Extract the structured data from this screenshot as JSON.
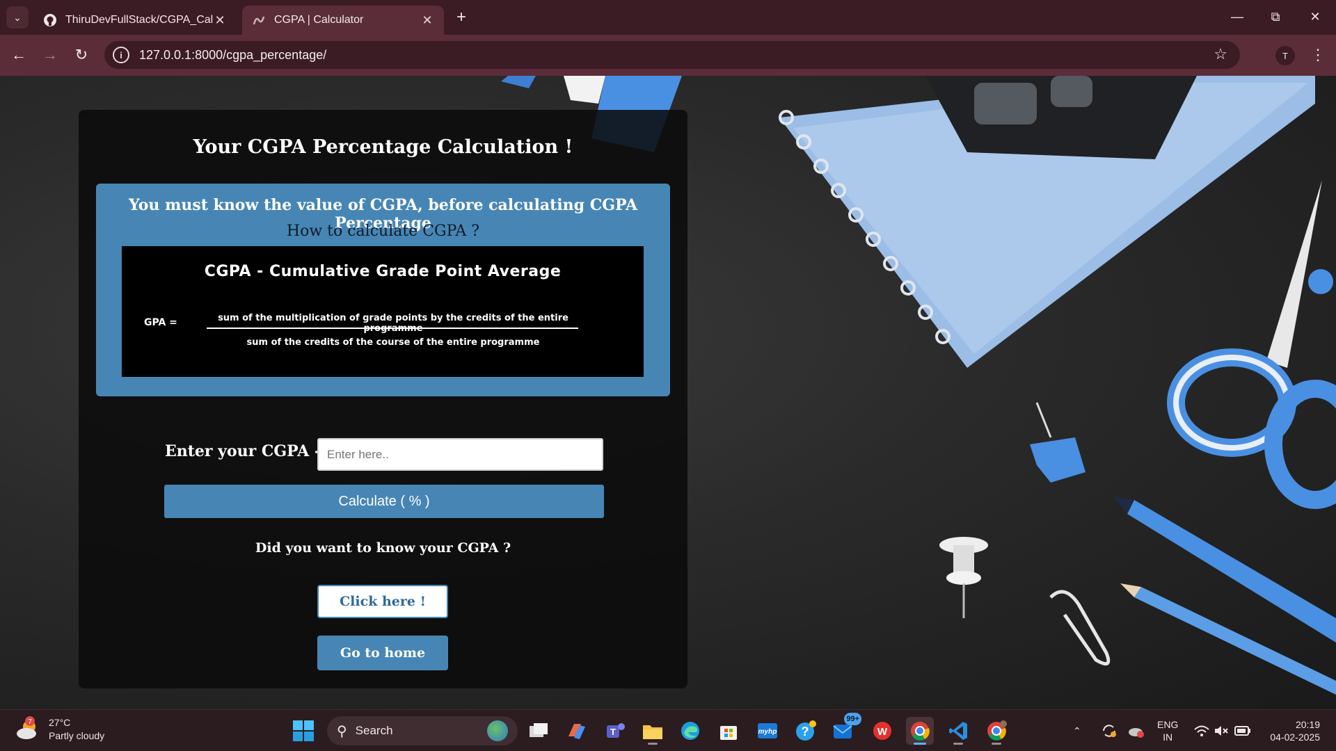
{
  "browser": {
    "tabs": [
      {
        "title": "ThiruDevFullStack/CGPA_Calcul",
        "active": false,
        "favicon": "github-icon"
      },
      {
        "title": "CGPA | Calculator",
        "active": true,
        "favicon": "snake-icon"
      }
    ],
    "new_tab": "+",
    "address": "127.0.0.1:8000/cgpa_percentage/",
    "profile_initial": "T"
  },
  "page": {
    "title": "Your CGPA Percentage Calculation !",
    "info_heading": "You must know the value of CGPA, before calculating CGPA Percentage",
    "info_subheading": "How to calculate CGPA ?",
    "formula": {
      "title": "CGPA - Cumulative Grade Point Average",
      "lhs": "GPA =",
      "numerator": "sum of the multiplication of grade points by the credits of the entire programme",
      "denominator": "sum of the credits of the course of the entire programme"
    },
    "input_label": "Enter your CGPA -",
    "input_placeholder": "Enter here..",
    "calculate_label": "Calculate ( % )",
    "want_text": "Did you want to know your CGPA ?",
    "click_here_label": "Click here !",
    "home_label": "Go to home"
  },
  "taskbar": {
    "weather_temp": "27°C",
    "weather_desc": "Partly cloudy",
    "weather_alert": "7",
    "search_label": "Search",
    "outlook_badge": "99+",
    "lang_top": "ENG",
    "lang_bottom": "IN",
    "time": "20:19",
    "date": "04-02-2025"
  },
  "colors": {
    "accent": "#4786b4",
    "card_bg": "#0a0a0a",
    "browser_frame": "#3b1b24",
    "toolbar": "#5a2d39"
  }
}
